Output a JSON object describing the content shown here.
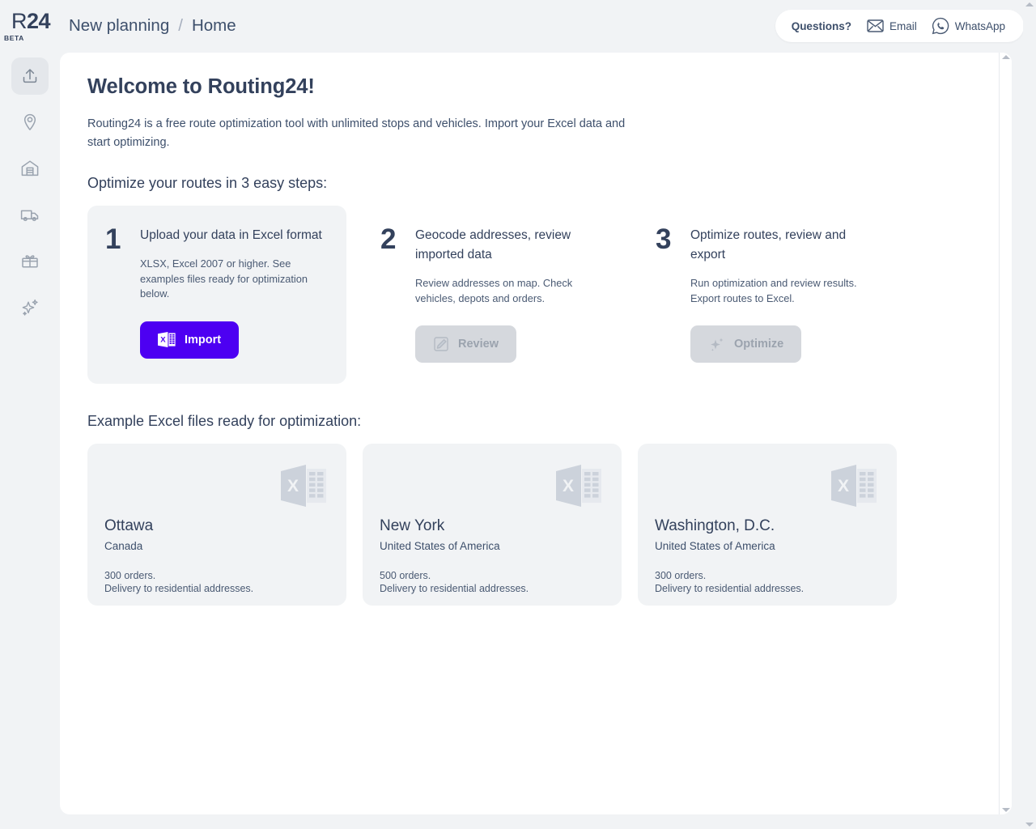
{
  "brand": {
    "logo_r": "R",
    "logo_24": "24",
    "logo_tag": "BETA",
    "accent_color": "#4d00f2"
  },
  "breadcrumb": {
    "planning": "New planning",
    "separator": "/",
    "current": "Home"
  },
  "help": {
    "label": "Questions?",
    "email": "Email",
    "whatsapp": "WhatsApp"
  },
  "sidebar": {
    "items": [
      {
        "name": "upload",
        "icon": "upload-icon",
        "active": true
      },
      {
        "name": "locations",
        "icon": "map-pin-icon",
        "active": false
      },
      {
        "name": "depots",
        "icon": "warehouse-icon",
        "active": false
      },
      {
        "name": "vehicles",
        "icon": "truck-icon",
        "active": false
      },
      {
        "name": "orders",
        "icon": "package-icon",
        "active": false
      },
      {
        "name": "optimize",
        "icon": "sparkles-icon",
        "active": false
      }
    ]
  },
  "main": {
    "welcome_title": "Welcome to Routing24!",
    "intro": "Routing24 is a free route optimization tool with unlimited stops and vehicles. Import your Excel data and start optimizing.",
    "steps_title": "Optimize your routes in 3 easy steps:",
    "examples_title": "Example Excel files ready for optimization:"
  },
  "steps": [
    {
      "number": "1",
      "heading": "Upload your data in Excel format",
      "description": "XLSX, Excel 2007 or higher. See examples files ready for optimization below.",
      "button_label": "Import",
      "button_icon": "excel-icon",
      "enabled": true
    },
    {
      "number": "2",
      "heading": "Geocode addresses, review imported data",
      "description": "Review addresses on map. Check vehicles, depots and orders.",
      "button_label": "Review",
      "button_icon": "pencil-square-icon",
      "enabled": false
    },
    {
      "number": "3",
      "heading": "Optimize routes, review and export",
      "description": "Run optimization and review results. Export routes to Excel.",
      "button_label": "Optimize",
      "button_icon": "sparkles-icon",
      "enabled": false
    }
  ],
  "examples": [
    {
      "city": "Ottawa",
      "country": "Canada",
      "orders": "300 orders.",
      "detail": "Delivery to residential addresses."
    },
    {
      "city": "New York",
      "country": "United States of America",
      "orders": "500 orders.",
      "detail": "Delivery to residential addresses."
    },
    {
      "city": "Washington, D.C.",
      "country": "United States of America",
      "orders": "300 orders.",
      "detail": "Delivery to residential addresses."
    }
  ]
}
